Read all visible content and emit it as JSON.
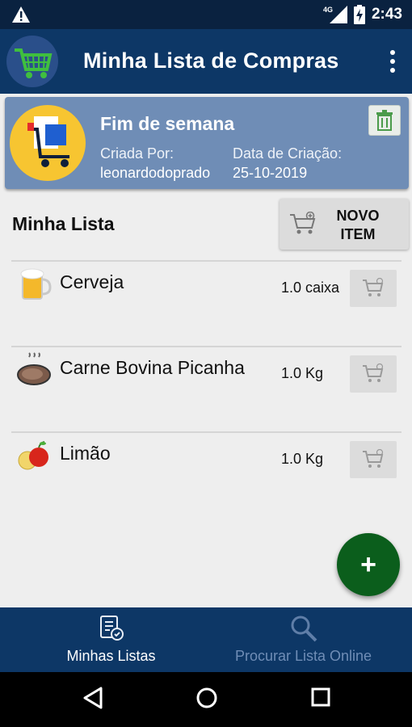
{
  "status_bar": {
    "network": "4G",
    "time": "2:43"
  },
  "app_bar": {
    "title": "Minha Lista de Compras"
  },
  "list_card": {
    "title": "Fim de semana",
    "created_by_label": "Criada Por:",
    "created_by": "leonardodoprado",
    "date_label": "Data de Criação:",
    "date": "25-10-2019"
  },
  "section": {
    "title": "Minha Lista",
    "new_item_line1": "NOVO",
    "new_item_line2": "ITEM"
  },
  "items": [
    {
      "icon": "beer-icon",
      "name": "Cerveja",
      "qty": "1.0 caixa"
    },
    {
      "icon": "steak-icon",
      "name": "Carne Bovina Picanha",
      "qty": "1.0 Kg"
    },
    {
      "icon": "fruit-icon",
      "name": "Limão",
      "qty": "1.0 Kg"
    }
  ],
  "fab": {
    "label": "+"
  },
  "bottom_nav": {
    "items": [
      {
        "label": "Minhas Listas",
        "active": true
      },
      {
        "label": "Procurar Lista Online",
        "active": false
      }
    ]
  },
  "colors": {
    "primary": "#0d3766",
    "card": "#6f8db6",
    "fab": "#0b5e1c",
    "inactive_nav": "#6f8db6"
  }
}
